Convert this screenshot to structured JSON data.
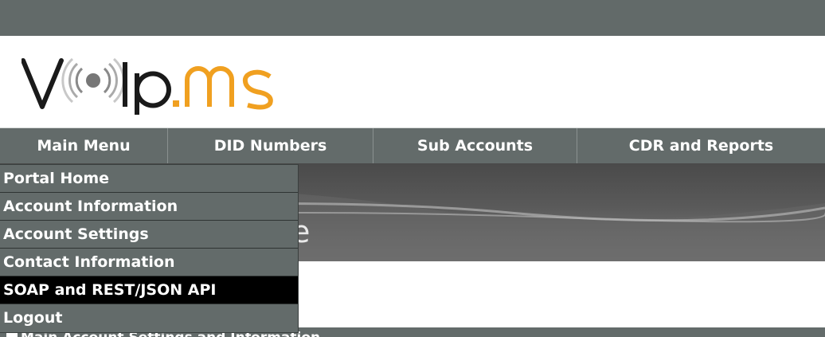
{
  "logo": {
    "text_left": "v",
    "text_right": "ip",
    "text_domain": ".ms",
    "colors": {
      "dark": "#1a1a1a",
      "accent": "#f0a020",
      "icon_gray": "#777777"
    }
  },
  "nav": {
    "items": [
      {
        "label": "Main Menu"
      },
      {
        "label": "DID Numbers"
      },
      {
        "label": "Sub Accounts"
      },
      {
        "label": "CDR and Reports"
      }
    ]
  },
  "dropdown": {
    "items": [
      {
        "label": "Portal Home"
      },
      {
        "label": "Account Information"
      },
      {
        "label": "Account Settings"
      },
      {
        "label": "Contact Information"
      },
      {
        "label": "SOAP and REST/JSON API",
        "active": true
      },
      {
        "label": "Logout"
      }
    ]
  },
  "banner": {
    "visible_fragment": "e"
  },
  "section": {
    "title": "Main Account Settings and Information"
  },
  "colors": {
    "bar": "#626a69",
    "active_item": "#000000",
    "text": "#ffffff"
  }
}
